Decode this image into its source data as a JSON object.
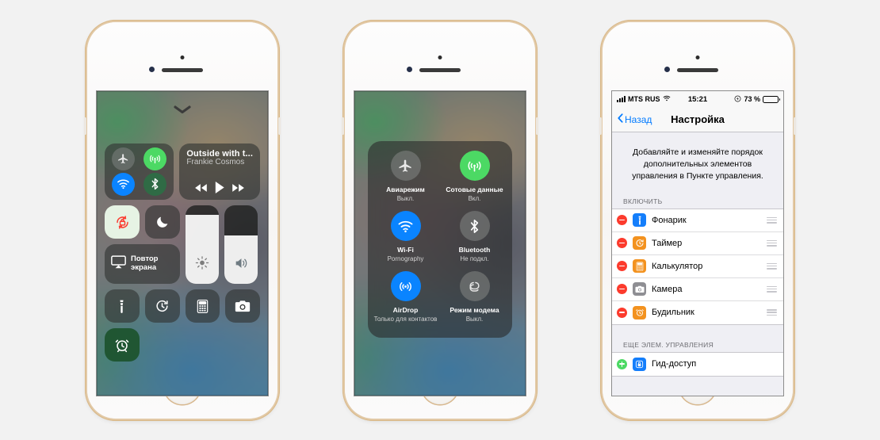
{
  "scene": {
    "background_color": "#f2f2f2",
    "device": "iPhone (white/gold)",
    "phones": 3
  },
  "phone1": {
    "name": "control-center-page-1",
    "dismiss_icon": "chevron-down-icon",
    "connectivity": {
      "airplane": {
        "icon": "airplane-icon",
        "state": "off"
      },
      "cellular": {
        "icon": "cellular-antenna-icon",
        "state": "on",
        "color": "#4cd964"
      },
      "wifi": {
        "icon": "wifi-icon",
        "state": "on",
        "color": "#0a84ff"
      },
      "bluetooth": {
        "icon": "bluetooth-icon",
        "state": "on",
        "color": "#2f6b45"
      }
    },
    "now_playing": {
      "title": "Outside with t...",
      "artist": "Frankie Cosmos",
      "previous_icon": "rewind-icon",
      "play_icon": "play-icon",
      "next_icon": "fast-forward-icon"
    },
    "rotation_lock": {
      "icon": "rotation-lock-icon",
      "state": "on",
      "color": "#fb3b30"
    },
    "do_not_disturb": {
      "icon": "moon-icon",
      "state": "off"
    },
    "screen_mirroring": {
      "icon": "airplay-icon",
      "label_line1": "Повтор",
      "label_line2": "экрана"
    },
    "brightness": {
      "icon": "brightness-sun-icon",
      "value": 88
    },
    "volume": {
      "icon": "volume-speaker-icon",
      "value": 62
    },
    "shortcuts": [
      {
        "icon": "flashlight-icon",
        "state": "off"
      },
      {
        "icon": "timer-icon",
        "state": "off"
      },
      {
        "icon": "calculator-icon",
        "state": "off"
      },
      {
        "icon": "camera-icon",
        "state": "off"
      },
      {
        "icon": "alarm-clock-icon",
        "state": "on"
      }
    ]
  },
  "phone2": {
    "name": "control-center-page-2-connectivity",
    "cells": [
      {
        "icon": "airplane-icon",
        "name": "Авиарежим",
        "state": "Выкл.",
        "active": false,
        "color": ""
      },
      {
        "icon": "cellular-antenna-icon",
        "name": "Сотовые данные",
        "state": "Вкл.",
        "active": true,
        "color": "#4cd964"
      },
      {
        "icon": "wifi-icon",
        "name": "Wi-Fi",
        "state": "Pornography",
        "active": true,
        "color": "#0a84ff"
      },
      {
        "icon": "bluetooth-icon",
        "name": "Bluetooth",
        "state": "Не подкл.",
        "active": false,
        "color": ""
      },
      {
        "icon": "airdrop-icon",
        "name": "AirDrop",
        "state": "Только для контактов",
        "active": true,
        "color": "#0a84ff"
      },
      {
        "icon": "personal-hotspot-icon",
        "name": "Режим модема",
        "state": "Выкл.",
        "active": false,
        "color": ""
      }
    ]
  },
  "phone3": {
    "name": "settings-customize-controls",
    "status_bar": {
      "carrier": "MTS RUS",
      "signal_icon": "signal-bars-icon",
      "wifi_icon": "wifi-icon",
      "time": "15:21",
      "lowpower_icon": "low-power-icon",
      "battery_percent": "73 %",
      "battery_level": 73,
      "battery_color": "#fdcf2f"
    },
    "nav": {
      "back_icon": "chevron-left-icon",
      "back_label": "Назад",
      "title": "Настройка"
    },
    "intro": "Добавляйте и изменяйте порядок дополнительных элементов управления в Пункте управления.",
    "section_include": {
      "header": "ВКЛЮЧИТЬ",
      "rows": [
        {
          "action": "remove",
          "action_icon": "minus-circle-icon",
          "icon": "flashlight-icon",
          "icon_color": "#147efb",
          "label": "Фонарик",
          "handle_icon": "reorder-handle-icon"
        },
        {
          "action": "remove",
          "action_icon": "minus-circle-icon",
          "icon": "timer-icon",
          "icon_color": "#f3921f",
          "label": "Таймер",
          "handle_icon": "reorder-handle-icon"
        },
        {
          "action": "remove",
          "action_icon": "minus-circle-icon",
          "icon": "calculator-icon",
          "icon_color": "#f3921f",
          "label": "Калькулятор",
          "handle_icon": "reorder-handle-icon"
        },
        {
          "action": "remove",
          "action_icon": "minus-circle-icon",
          "icon": "camera-icon",
          "icon_color": "#8e8e93",
          "label": "Камера",
          "handle_icon": "reorder-handle-icon"
        },
        {
          "action": "remove",
          "action_icon": "minus-circle-icon",
          "icon": "alarm-clock-icon",
          "icon_color": "#f3921f",
          "label": "Будильник",
          "handle_icon": "reorder-handle-icon"
        }
      ]
    },
    "section_more": {
      "header": "ЕЩЕ ЭЛЕМ. УПРАВЛЕНИЯ",
      "rows": [
        {
          "action": "add",
          "action_icon": "plus-circle-icon",
          "icon": "guided-access-lock-icon",
          "icon_color": "#147efb",
          "label": "Гид-доступ"
        }
      ]
    }
  }
}
